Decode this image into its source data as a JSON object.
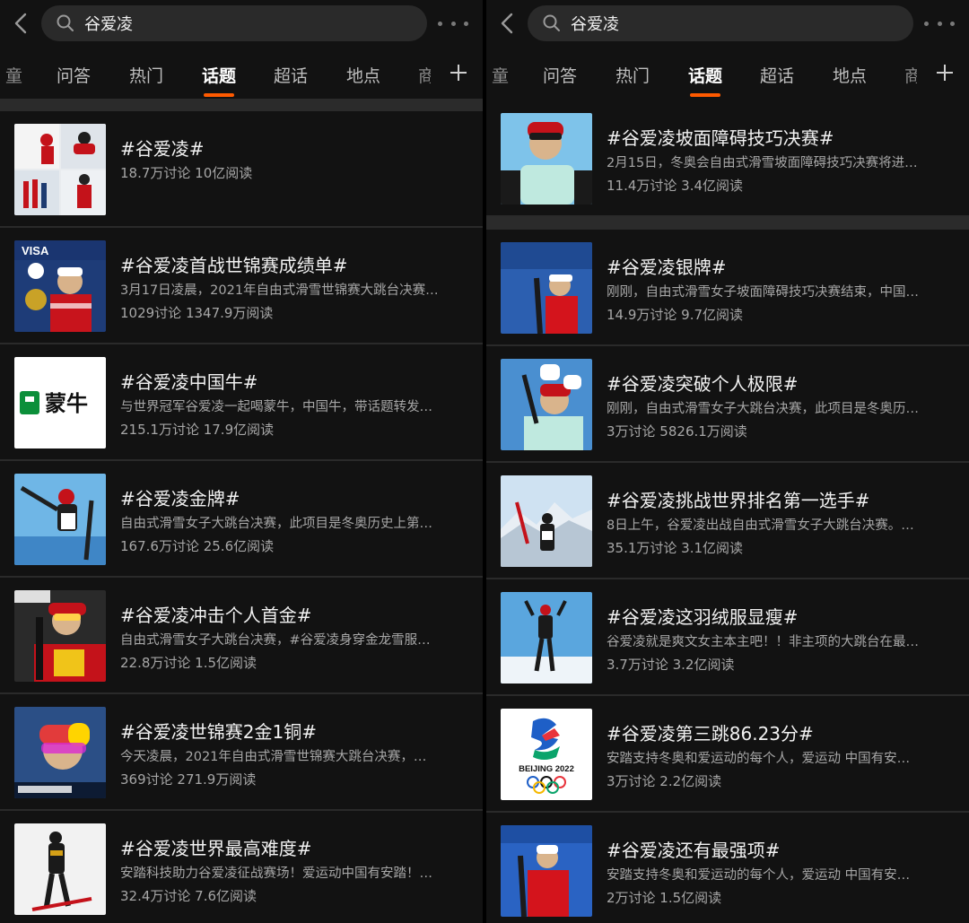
{
  "left": {
    "search_text": "谷爱凌",
    "tabs": [
      "童",
      "问答",
      "热门",
      "话题",
      "超话",
      "地点",
      "商"
    ],
    "items": [
      {
        "title": "#谷爱凌#",
        "desc": "",
        "stats": "18.7万讨论 10亿阅读"
      },
      {
        "title": "#谷爱凌首战世锦赛成绩单#",
        "desc": "3月17日凌晨，2021年自由式滑雪世锦赛大跳台决赛…",
        "stats": "1029讨论 1347.9万阅读"
      },
      {
        "title": "#谷爱凌中国牛#",
        "desc": "与世界冠军谷爱凌一起喝蒙牛，中国牛，带话题转发…",
        "stats": "215.1万讨论 17.9亿阅读"
      },
      {
        "title": "#谷爱凌金牌#",
        "desc": "自由式滑雪女子大跳台决赛，此项目是冬奥历史上第…",
        "stats": "167.6万讨论 25.6亿阅读"
      },
      {
        "title": "#谷爱凌冲击个人首金#",
        "desc": "自由式滑雪女子大跳台决赛，#谷爱凌身穿金龙雪服…",
        "stats": "22.8万讨论 1.5亿阅读"
      },
      {
        "title": "#谷爱凌世锦赛2金1铜#",
        "desc": "今天凌晨，2021年自由式滑雪世锦赛大跳台决赛，…",
        "stats": "369讨论 271.9万阅读"
      },
      {
        "title": "#谷爱凌世界最高难度#",
        "desc": "安踏科技助力谷爱凌征战赛场！爱运动中国有安踏！…",
        "stats": "32.4万讨论 7.6亿阅读"
      }
    ]
  },
  "right": {
    "search_text": "谷爱凌",
    "tabs": [
      "童",
      "问答",
      "热门",
      "话题",
      "超话",
      "地点",
      "商"
    ],
    "items": [
      {
        "title": "#谷爱凌坡面障碍技巧决赛#",
        "desc": "2月15日，冬奥会自由式滑雪坡面障碍技巧决赛将进…",
        "stats": "11.4万讨论 3.4亿阅读"
      },
      {
        "title": "#谷爱凌银牌#",
        "desc": "刚刚，自由式滑雪女子坡面障碍技巧决赛结束，中国…",
        "stats": "14.9万讨论 9.7亿阅读"
      },
      {
        "title": "#谷爱凌突破个人极限#",
        "desc": "刚刚，自由式滑雪女子大跳台决赛，此项目是冬奥历…",
        "stats": "3万讨论 5826.1万阅读"
      },
      {
        "title": "#谷爱凌挑战世界排名第一选手#",
        "desc": "8日上午，谷爱凌出战自由式滑雪女子大跳台决赛。…",
        "stats": "35.1万讨论 3.1亿阅读"
      },
      {
        "title": "#谷爱凌这羽绒服显瘦#",
        "desc": "谷爱凌就是爽文女主本主吧！！非主项的大跳台在最…",
        "stats": "3.7万讨论 3.2亿阅读"
      },
      {
        "title": "#谷爱凌第三跳86.23分#",
        "desc": "安踏支持冬奥和爱运动的每个人，爱运动 中国有安…",
        "stats": "3万讨论 2.2亿阅读"
      },
      {
        "title": "#谷爱凌还有最强项#",
        "desc": "安踏支持冬奥和爱运动的每个人，爱运动 中国有安…",
        "stats": "2万讨论 1.5亿阅读"
      }
    ]
  },
  "thumb_text": {
    "visa": "VISA",
    "mengniu": "蒙牛",
    "beijing": "BEIJING 2022"
  },
  "colors": {
    "accent": "#ff5a00",
    "background": "#121212",
    "search_bg": "#2a2a2a"
  }
}
